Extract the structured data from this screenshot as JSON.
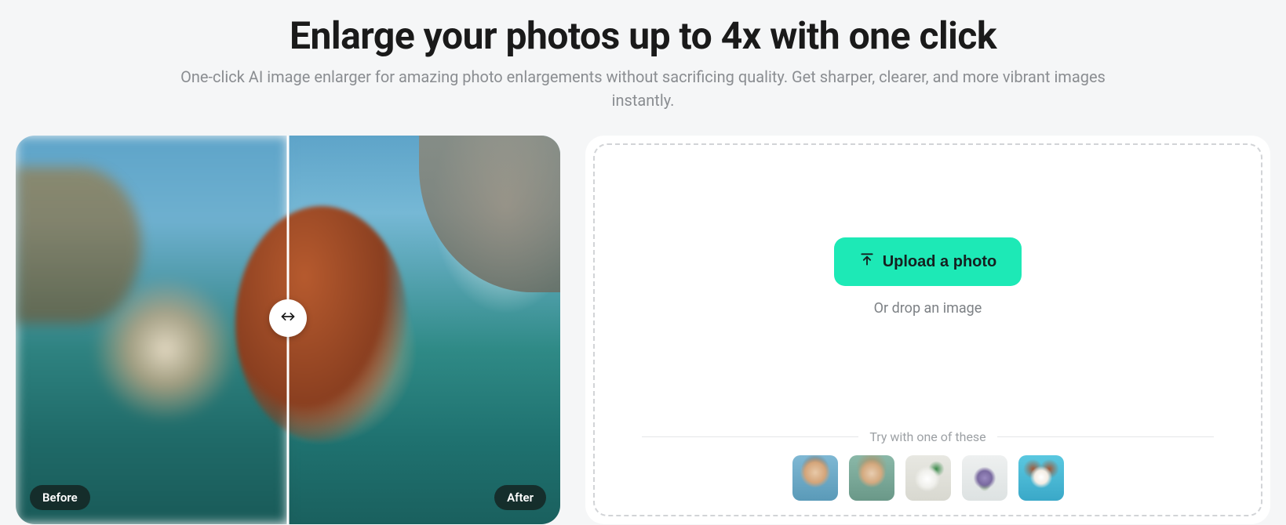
{
  "header": {
    "headline": "Enlarge your photos up to 4x with one click",
    "subheadline": "One-click AI image enlarger for amazing photo enlargements without sacrificing quality. Get sharper, clearer, and more vibrant images instantly."
  },
  "comparison": {
    "before_label": "Before",
    "after_label": "After"
  },
  "upload": {
    "button_label": "Upload a photo",
    "drop_text": "Or drop an image",
    "samples_label": "Try with one of these",
    "samples": [
      {
        "name": "sample-man-beach"
      },
      {
        "name": "sample-woman-outdoor"
      },
      {
        "name": "sample-product-jar"
      },
      {
        "name": "sample-flower-crocus"
      },
      {
        "name": "sample-puppy"
      }
    ]
  },
  "colors": {
    "accent": "#1de9b6",
    "text_primary": "#1a1a1a",
    "text_secondary": "#8a8d91"
  }
}
